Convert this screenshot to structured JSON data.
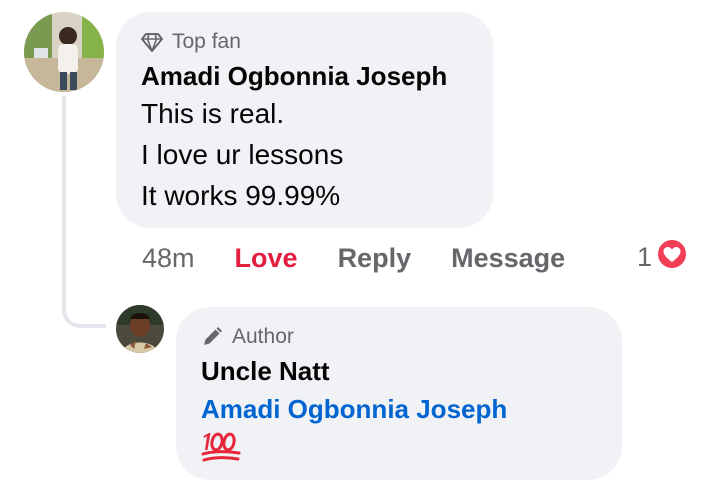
{
  "comment": {
    "badge": "Top fan",
    "author": "Amadi Ogbonnia Joseph",
    "lines": [
      "This is real.",
      "I love ur lessons",
      "It works 99.99%"
    ],
    "time": "48m",
    "love_label": "Love",
    "reply_label": "Reply",
    "message_label": "Message",
    "reaction_count": "1",
    "reaction_icon": "heart-icon",
    "badge_icon": "diamond-icon",
    "accent_love": "#e41e3f"
  },
  "reply": {
    "badge": "Author",
    "author": "Uncle Natt",
    "mention": "Amadi Ogbonnia Joseph",
    "emoji_icon": "hundred-points-icon",
    "badge_icon": "pencil-icon",
    "mention_color": "#0064d1"
  }
}
